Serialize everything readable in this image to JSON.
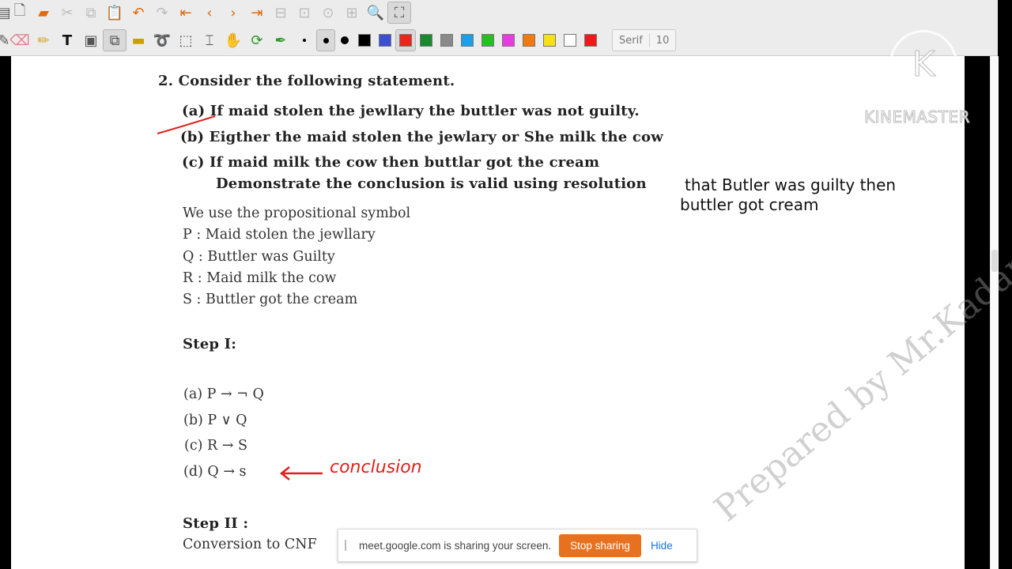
{
  "toolbar": {
    "font_name": "Serif",
    "font_size": "10",
    "colors": [
      "#000000",
      "#3c4fd0",
      "#e8261a",
      "#1a8a2e",
      "#8a8a8a",
      "#1aa0e8",
      "#22c222",
      "#e83ce0",
      "#f07a10",
      "#f5e01a",
      "#ffffff",
      "#f01818"
    ],
    "selected_color": "#e8261a"
  },
  "document": {
    "question_heading": "2.  Consider the following statement.",
    "stmt_a": "(a)  If maid stolen the jewllary the buttler was not guilty.",
    "stmt_b": "(b)  Eigther the maid stolen the jewlary or She milk the cow",
    "stmt_c": "(c)  If maid milk the cow then buttlar got the cream",
    "demonstrate": "Demonstrate the conclusion is valid using resolution",
    "handwritten_1": "that Butler was guilty then",
    "handwritten_2": "buttler got cream",
    "intro": "We use the propositional symbol",
    "symbols": [
      "P : Maid stolen the jewllary",
      "Q : Buttler was Guilty",
      "R : Maid milk the cow",
      "S : Buttler got the cream"
    ],
    "step1": "Step I:",
    "formulas": [
      "(a)  P → ¬ Q",
      "(b)  P ∨ Q",
      "(c)  R → S",
      "(d)  Q → s"
    ],
    "conclusion_note": "conclusion",
    "step2": "Step II :",
    "step2_text": "Conversion to CNF",
    "watermark": "Prepared by Mr.Kadam S B)"
  },
  "kinemaster": "KINEMASTER",
  "share": {
    "message": "meet.google.com is sharing your screen.",
    "stop_label": "Stop sharing",
    "hide_label": "Hide"
  },
  "annotation_color": "#e0201a"
}
